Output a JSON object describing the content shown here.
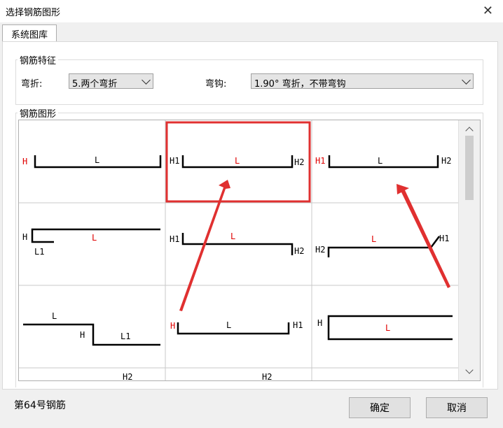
{
  "window": {
    "title": "选择钢筋图形",
    "close_glyph": "✕"
  },
  "tabs": [
    {
      "label": "系统图库"
    }
  ],
  "feature_group": {
    "title": "钢筋特征",
    "bend_label": "弯折:",
    "bend_value": "5.两个弯折",
    "hook_label": "弯钩:",
    "hook_value": "1.90° 弯折，不带弯钩"
  },
  "shape_group": {
    "title": "钢筋图形"
  },
  "shapes": [
    {
      "labels": [
        "H",
        "L"
      ]
    },
    {
      "labels": [
        "H1",
        "L",
        "H2"
      ],
      "selected": true
    },
    {
      "labels": [
        "H1",
        "L",
        "H2"
      ]
    },
    {
      "labels": [
        "H",
        "L",
        "L1"
      ]
    },
    {
      "labels": [
        "H1",
        "L",
        "H2"
      ]
    },
    {
      "labels": [
        "H2",
        "L",
        "H1"
      ]
    },
    {
      "labels": [
        "L",
        "H",
        "L1"
      ]
    },
    {
      "labels": [
        "H",
        "L",
        "H1"
      ]
    },
    {
      "labels": [
        "H",
        "L"
      ]
    },
    {
      "labels": [
        "H2"
      ]
    },
    {
      "labels": [
        "H2"
      ]
    },
    {
      "labels": []
    }
  ],
  "status": "第64号钢筋",
  "buttons": {
    "ok": "确定",
    "cancel": "取消"
  },
  "colors": {
    "highlight": "#e03030",
    "label_red": "#e00000"
  }
}
